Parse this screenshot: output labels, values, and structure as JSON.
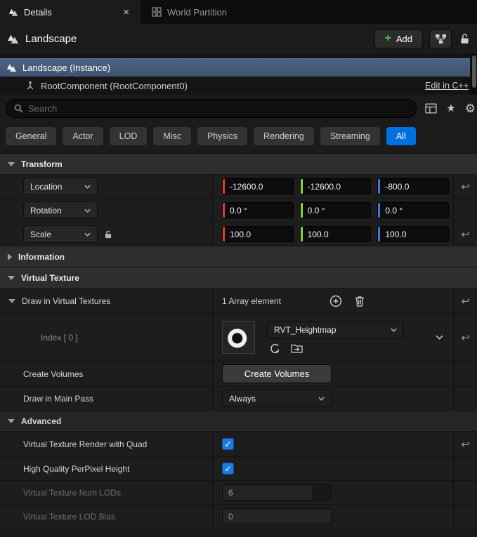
{
  "tabs": {
    "details": "Details",
    "world_partition": "World Partition",
    "close": "×"
  },
  "header": {
    "title": "Landscape",
    "add": "Add",
    "plus": "+"
  },
  "tree": {
    "instance": "Landscape (Instance)",
    "component": "RootComponent (RootComponent0)",
    "edit_cpp": "Edit in C++"
  },
  "search": {
    "placeholder": "Search",
    "star": "★",
    "gear": "⚙"
  },
  "filters": [
    {
      "label": "General"
    },
    {
      "label": "Actor"
    },
    {
      "label": "LOD"
    },
    {
      "label": "Misc"
    },
    {
      "label": "Physics"
    },
    {
      "label": "Rendering"
    },
    {
      "label": "Streaming"
    },
    {
      "label": "All",
      "active": true
    }
  ],
  "transform": {
    "title": "Transform",
    "location": {
      "label": "Location",
      "x": "-12600.0",
      "y": "-12600.0",
      "z": "-800.0"
    },
    "rotation": {
      "label": "Rotation",
      "x": "0.0 °",
      "y": "0.0 °",
      "z": "0.0 °"
    },
    "scale": {
      "label": "Scale",
      "x": "100.0",
      "y": "100.0",
      "z": "100.0"
    }
  },
  "information": {
    "title": "Information"
  },
  "virtual_texture": {
    "title": "Virtual Texture",
    "draw_label": "Draw in Virtual Textures",
    "array_count": "1 Array element",
    "index_label": "Index [ 0 ]",
    "asset_name": "RVT_Heightmap",
    "create_volumes_label": "Create Volumes",
    "create_volumes_button": "Create Volumes",
    "main_pass_label": "Draw in Main Pass",
    "main_pass_value": "Always",
    "advanced_title": "Advanced",
    "quad_label": "Virtual Texture Render with Quad",
    "perpixel_label": "High Quality PerPixel Height",
    "num_lods_label": "Virtual Texture Num LODs",
    "num_lods_value": "6",
    "lod_bias_label": "Virtual Texture LOD Bias",
    "lod_bias_value": "0"
  },
  "colors": {
    "accent": "#0070e0",
    "axis_x": "#e0393f",
    "axis_y": "#8bd938",
    "axis_z": "#3b7ddd",
    "checkbox": "#1e7be0"
  },
  "misc": {
    "revert": "↩",
    "check": "✓"
  }
}
